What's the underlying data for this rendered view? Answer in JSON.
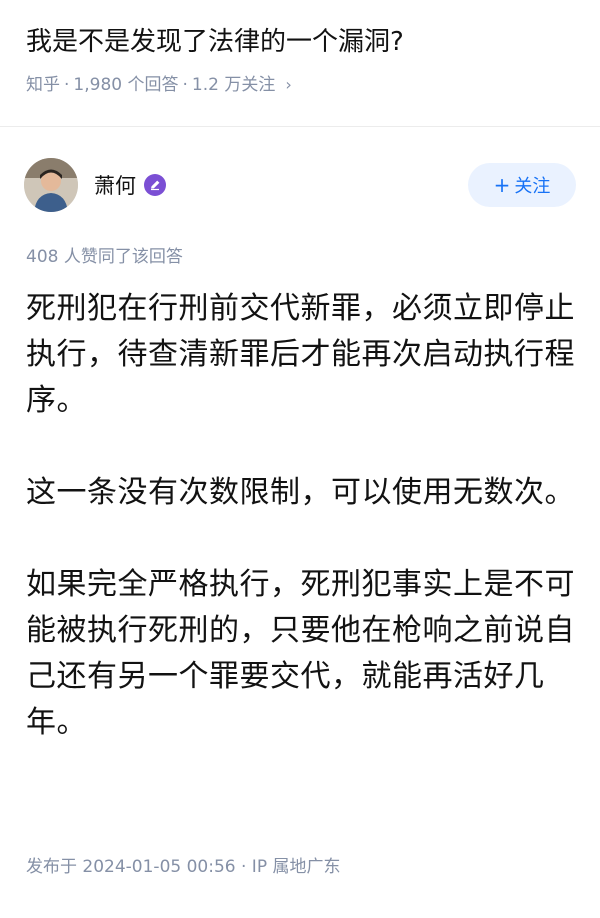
{
  "question": {
    "title": "我是不是发现了法律的一个漏洞?",
    "source": "知乎",
    "answers": "1,980 个回答",
    "followers": "1.2 万关注"
  },
  "author": {
    "name": "萧何",
    "follow_label": "关注"
  },
  "answer": {
    "likes_text": "408 人赞同了该回答",
    "paragraphs": [
      "死刑犯在行刑前交代新罪，必须立即停止执行，待查清新罪后才能再次启动执行程序。",
      "这一条没有次数限制，可以使用无数次。",
      "如果完全严格执行，死刑犯事实上是不可能被执行死刑的，只要他在枪响之前说自己还有另一个罪要交代，就能再活好几年。"
    ],
    "published": "发布于 2024-01-05 00:56 · IP 属地广东"
  },
  "colors": {
    "accent": "#1772f6",
    "muted": "#8590a6",
    "badge": "#7b4fd4"
  },
  "icons": {
    "badge": "pencil-badge-icon",
    "chevron": "chevron-right-icon",
    "plus": "plus-icon"
  }
}
